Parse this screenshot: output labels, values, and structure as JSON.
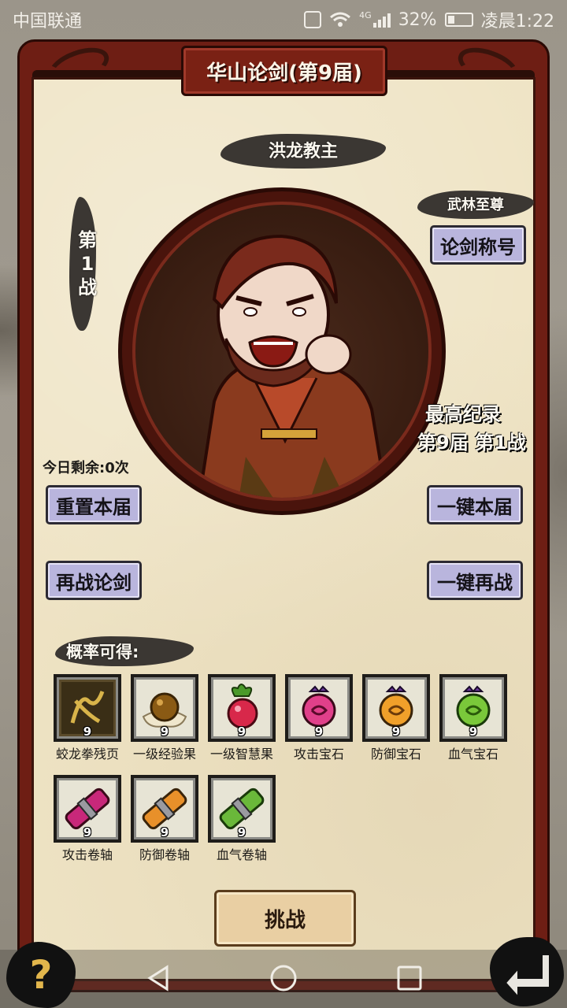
{
  "status_bar": {
    "carrier": "中国联通",
    "network": "4G",
    "battery": "32%",
    "time": "凌晨1:22"
  },
  "title": "华山论剑(第9届)",
  "opponent_name": "洪龙教主",
  "battle_number": {
    "line1": "第",
    "line2": "1",
    "line3": "战"
  },
  "rank_title": "武林至尊",
  "buttons": {
    "title_btn": "论剑称号",
    "reset": "重置本届",
    "one_key_current": "一键本届",
    "rechallenge": "再战论剑",
    "one_key_again": "一键再战",
    "challenge": "挑战"
  },
  "best_record": {
    "label": "最高纪录",
    "value": "第9届 第1战"
  },
  "remaining": "今日剩余:0次",
  "rewards_label": "概率可得:",
  "rewards": [
    {
      "name": "蛟龙拳残页",
      "count": "9",
      "icon": "dragon-page-icon"
    },
    {
      "name": "一级经验果",
      "count": "9",
      "icon": "exp-fruit-icon"
    },
    {
      "name": "一级智慧果",
      "count": "9",
      "icon": "wisdom-fruit-icon"
    },
    {
      "name": "攻击宝石",
      "count": "9",
      "icon": "attack-gem-icon"
    },
    {
      "name": "防御宝石",
      "count": "9",
      "icon": "defense-gem-icon"
    },
    {
      "name": "血气宝石",
      "count": "9",
      "icon": "hp-gem-icon"
    },
    {
      "name": "攻击卷轴",
      "count": "9",
      "icon": "attack-scroll-icon"
    },
    {
      "name": "防御卷轴",
      "count": "9",
      "icon": "defense-scroll-icon"
    },
    {
      "name": "血气卷轴",
      "count": "9",
      "icon": "hp-scroll-icon"
    }
  ],
  "help_symbol": "?",
  "colors": {
    "frame": "#6e1e14",
    "panel": "#efe4c5",
    "button": "#b9b5dd",
    "challenge_button": "#e9cfa3"
  }
}
